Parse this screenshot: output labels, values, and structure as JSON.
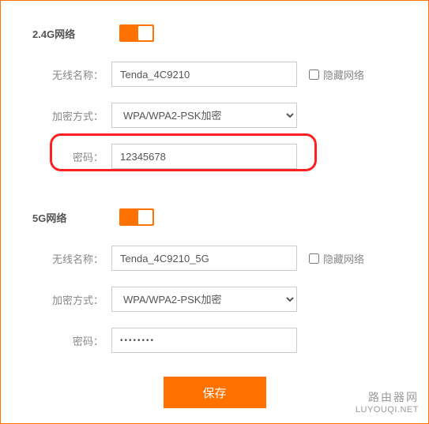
{
  "network24": {
    "title": "2.4G网络",
    "ssid_label": "无线名称：",
    "ssid_value": "Tenda_4C9210",
    "hide_label": "隐藏网络",
    "encryption_label": "加密方式：",
    "encryption_value": "WPA/WPA2-PSK加密",
    "password_label": "密码：",
    "password_value": "12345678"
  },
  "network5": {
    "title": "5G网络",
    "ssid_label": "无线名称：",
    "ssid_value": "Tenda_4C9210_5G",
    "hide_label": "隐藏网络",
    "encryption_label": "加密方式：",
    "encryption_value": "WPA/WPA2-PSK加密",
    "password_label": "密码：",
    "password_value": "••••••••"
  },
  "save_label": "保存",
  "watermark": {
    "line1": "路由器网",
    "line2": "LUYOUQI.NET"
  }
}
